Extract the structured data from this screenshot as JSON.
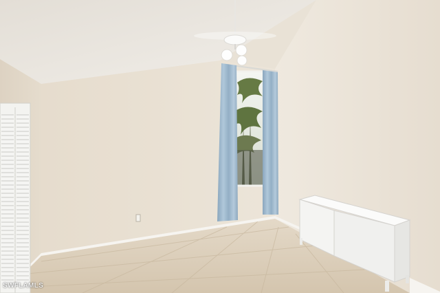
{
  "watermark": "SWFLAMLS",
  "colors": {
    "wall_left": "#e8e0d3",
    "wall_right": "#ebe4d8",
    "ceiling": "#ece8e2",
    "floor": "#ddd0bc",
    "curtain": "#9fb9cd",
    "baseboard": "#f6f4f0",
    "cabinet": "#f7f7f5"
  },
  "objects": [
    "ceiling-fan",
    "window",
    "curtains",
    "louvered-closet-door",
    "white-cabinet",
    "electrical-outlet",
    "tile-floor"
  ]
}
